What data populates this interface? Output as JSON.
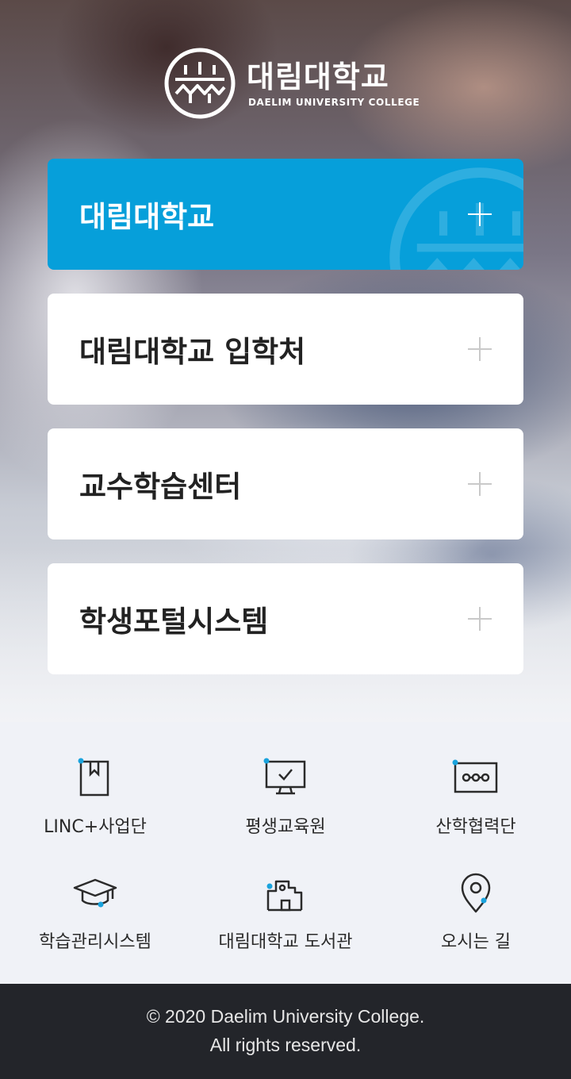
{
  "logo": {
    "name_ko": "대림대학교",
    "name_en": "DAELIM UNIVERSITY COLLEGE"
  },
  "menu": {
    "items": [
      {
        "label": "대림대학교",
        "active": true
      },
      {
        "label": "대림대학교 입학처",
        "active": false
      },
      {
        "label": "교수학습센터",
        "active": false
      },
      {
        "label": "학생포털시스템",
        "active": false
      }
    ]
  },
  "quick_links": {
    "items": [
      {
        "label": "LINC+사업단",
        "icon": "bookmark-book-icon"
      },
      {
        "label": "평생교육원",
        "icon": "monitor-check-icon"
      },
      {
        "label": "산학협력단",
        "icon": "network-card-icon"
      },
      {
        "label": "학습관리시스템",
        "icon": "graduation-cap-icon"
      },
      {
        "label": "대림대학교 도서관",
        "icon": "library-building-icon"
      },
      {
        "label": "오시는 길",
        "icon": "map-pin-icon"
      }
    ]
  },
  "colors": {
    "accent_blue": "#069fda",
    "dot_blue": "#1aa3dd",
    "quick_bg": "#f0f2f7",
    "footer_bg": "#23252a"
  },
  "footer": {
    "copyright": "© 2020 Daelim University College.",
    "rights": "All rights reserved."
  }
}
